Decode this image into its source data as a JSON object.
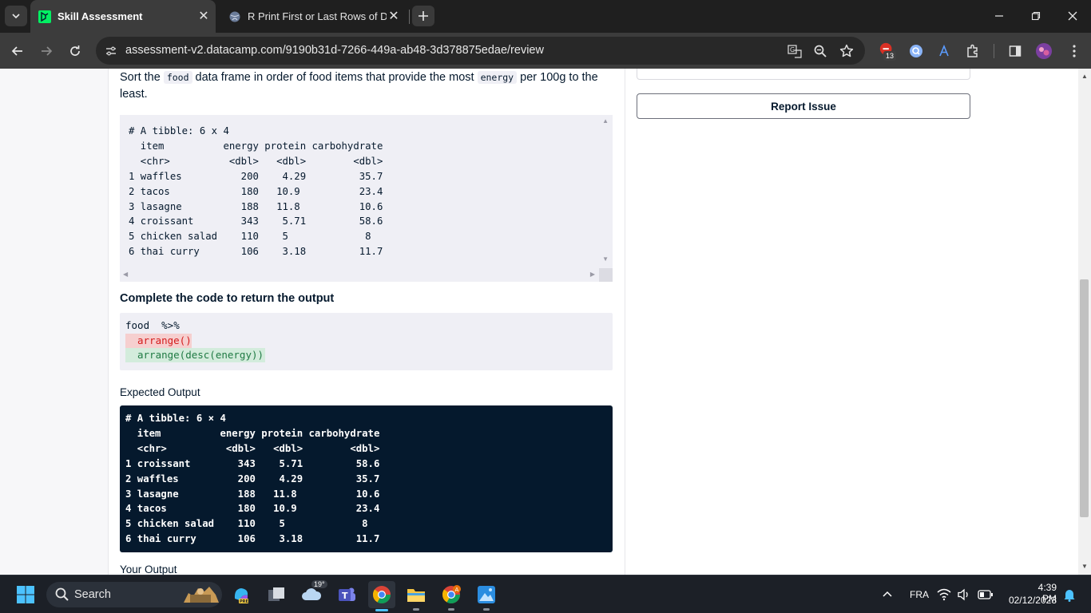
{
  "browser": {
    "tabs": [
      {
        "title": "Skill Assessment",
        "active": true
      },
      {
        "title": "R Print First or Last Rows of Da",
        "active": false
      }
    ],
    "url": "assessment-v2.datacamp.com/9190b31d-7266-449a-ab48-3d378875edae/review",
    "extension_badge": "13"
  },
  "sidebar": {
    "report_issue_label": "Report Issue"
  },
  "question": {
    "text_before": "Sort the",
    "code_food": "food",
    "text_middle": "data frame in order of food items that provide the most",
    "code_energy": "energy",
    "text_after": "per 100g to the least."
  },
  "input_tibble": {
    "text": "# A tibble: 6 x 4\n  item          energy protein carbohydrate\n  <chr>          <dbl>   <dbl>        <dbl>\n1 waffles          200    4.29         35.7\n2 tacos            180   10.9          23.4\n3 lasagne          188   11.8          10.6\n4 croissant        343    5.71         58.6\n5 chicken salad    110    5             8  \n6 thai curry       106    3.18         11.7"
  },
  "complete_code": {
    "heading": "Complete the code to return the output",
    "line1": "food  %>%",
    "removed": "arrange()",
    "added": "arrange(desc(energy))"
  },
  "expected_output": {
    "heading": "Expected Output",
    "text": "# A tibble: 6 × 4\n  item          energy protein carbohydrate\n  <chr>          <dbl>   <dbl>        <dbl>\n1 croissant        343    5.71         58.6\n2 waffles          200    4.29         35.7\n3 lasagne          188   11.8          10.6\n4 tacos            180   10.9          23.4\n5 chicken salad    110    5             8  \n6 thai curry       106    3.18         11.7"
  },
  "your_output": {
    "heading": "Your Output"
  },
  "taskbar": {
    "search_label": "Search",
    "weather_temp": "19°",
    "language": "FRA",
    "time": "4:39 PM",
    "date": "02/12/2023"
  }
}
